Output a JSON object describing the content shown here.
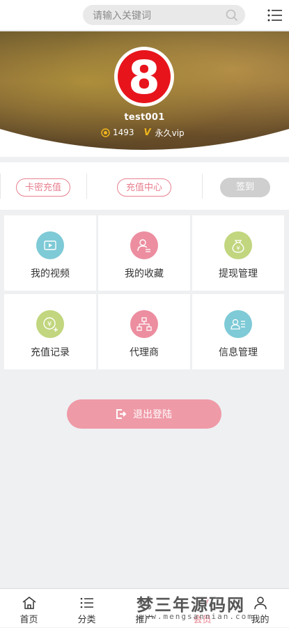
{
  "search": {
    "placeholder": "请输入关键词"
  },
  "profile": {
    "logo_text": "8",
    "username": "test001",
    "coins": "1493",
    "vip_badge": "V",
    "vip_status": "永久vip"
  },
  "actions": [
    {
      "label": "卡密充值"
    },
    {
      "label": "充值中心"
    },
    {
      "label": "签到"
    }
  ],
  "grid": [
    {
      "label": "我的视频",
      "icon": "video-icon",
      "color": "#7ecad6"
    },
    {
      "label": "我的收藏",
      "icon": "favorite-user-icon",
      "color": "#ec8ea0"
    },
    {
      "label": "提现管理",
      "icon": "money-bag-icon",
      "color": "#c1d67e"
    },
    {
      "label": "充值记录",
      "icon": "recharge-yen-icon",
      "color": "#c1d67e"
    },
    {
      "label": "代理商",
      "icon": "hierarchy-icon",
      "color": "#ec8ea0"
    },
    {
      "label": "信息管理",
      "icon": "user-info-icon",
      "color": "#7ecad6"
    }
  ],
  "logout": {
    "label": "退出登陆"
  },
  "bottom_nav": [
    {
      "label": "首页",
      "icon": "home-icon"
    },
    {
      "label": "分类",
      "icon": "list-icon"
    },
    {
      "label": "推广",
      "icon": "share-icon"
    },
    {
      "label": "会员",
      "icon": "vip-icon"
    },
    {
      "label": "我的",
      "icon": "user-icon"
    }
  ],
  "watermark": {
    "title": "梦三年源码网",
    "url": "www.mengsannian.com"
  },
  "colors": {
    "accent": "#e8808f",
    "logout_bg": "#ef9aa7",
    "checkin_bg": "#cfcfcf",
    "vip": "#f1b51c"
  }
}
